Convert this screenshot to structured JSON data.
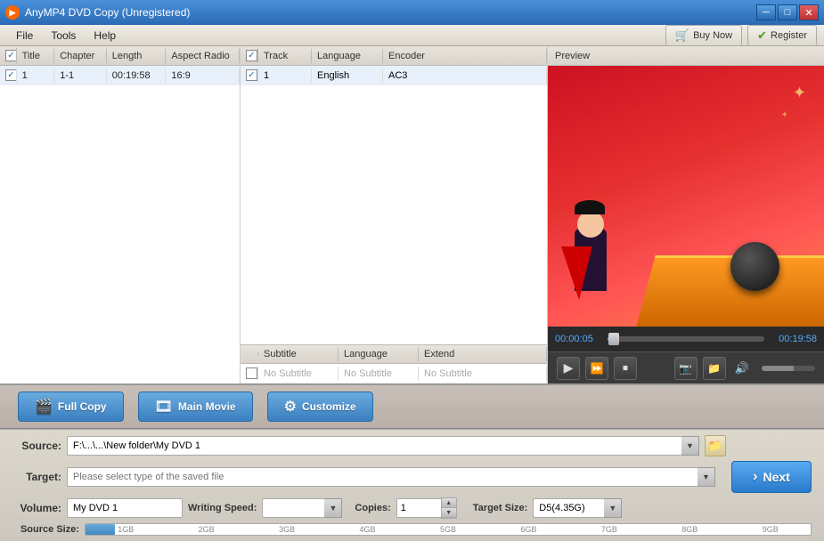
{
  "titleBar": {
    "title": "AnyMP4 DVD Copy (Unregistered)",
    "minimize": "─",
    "maximize": "□",
    "close": "✕"
  },
  "menuBar": {
    "items": [
      {
        "id": "file",
        "label": "File"
      },
      {
        "id": "tools",
        "label": "Tools"
      },
      {
        "id": "help",
        "label": "Help"
      }
    ]
  },
  "toolbar": {
    "buyNow": "Buy Now",
    "register": "Register"
  },
  "trackTable": {
    "headers": {
      "check": "",
      "title": "Title",
      "chapter": "Chapter",
      "length": "Length",
      "aspect": "Aspect Radio"
    },
    "rows": [
      {
        "checked": true,
        "title": "1",
        "chapter": "1-1",
        "length": "00:19:58",
        "aspect": "16:9"
      }
    ]
  },
  "audioTable": {
    "headers": {
      "check": "",
      "track": "Track",
      "language": "Language",
      "encoder": "Encoder"
    },
    "rows": [
      {
        "checked": true,
        "track": "1",
        "language": "English",
        "encoder": "AC3"
      }
    ]
  },
  "subtitleTable": {
    "headers": {
      "check": "",
      "subtitle": "Subtitle",
      "language": "Language",
      "extend": "Extend"
    },
    "rows": [
      {
        "checked": false,
        "subtitle": "No Subtitle",
        "language": "No Subtitle",
        "extend": "No Subtitle"
      }
    ]
  },
  "preview": {
    "label": "Preview",
    "timeStart": "00:00:05",
    "timeEnd": "00:19:58",
    "progressPercent": 4
  },
  "actionButtons": {
    "fullCopy": "Full Copy",
    "mainMovie": "Main Movie",
    "customize": "Customize"
  },
  "form": {
    "sourceLabel": "Source:",
    "sourceValue": "F:\\...\\...\\New folder\\My DVD 1",
    "targetLabel": "Target:",
    "targetPlaceholder": "Please select type of the saved file",
    "volumeLabel": "Volume:",
    "volumeValue": "My DVD 1",
    "writingSpeedLabel": "Writing Speed:",
    "writingSpeedValue": "",
    "copiesLabel": "Copies:",
    "copiesValue": "1",
    "targetSizeLabel": "Target Size:",
    "targetSizeValue": "D5(4.35G)",
    "sourceSizeLabel": "Source Size:",
    "nextLabel": "Next",
    "sizeMarkers": [
      "1GB",
      "2GB",
      "3GB",
      "4GB",
      "5GB",
      "6GB",
      "7GB",
      "8GB",
      "9GB"
    ]
  }
}
